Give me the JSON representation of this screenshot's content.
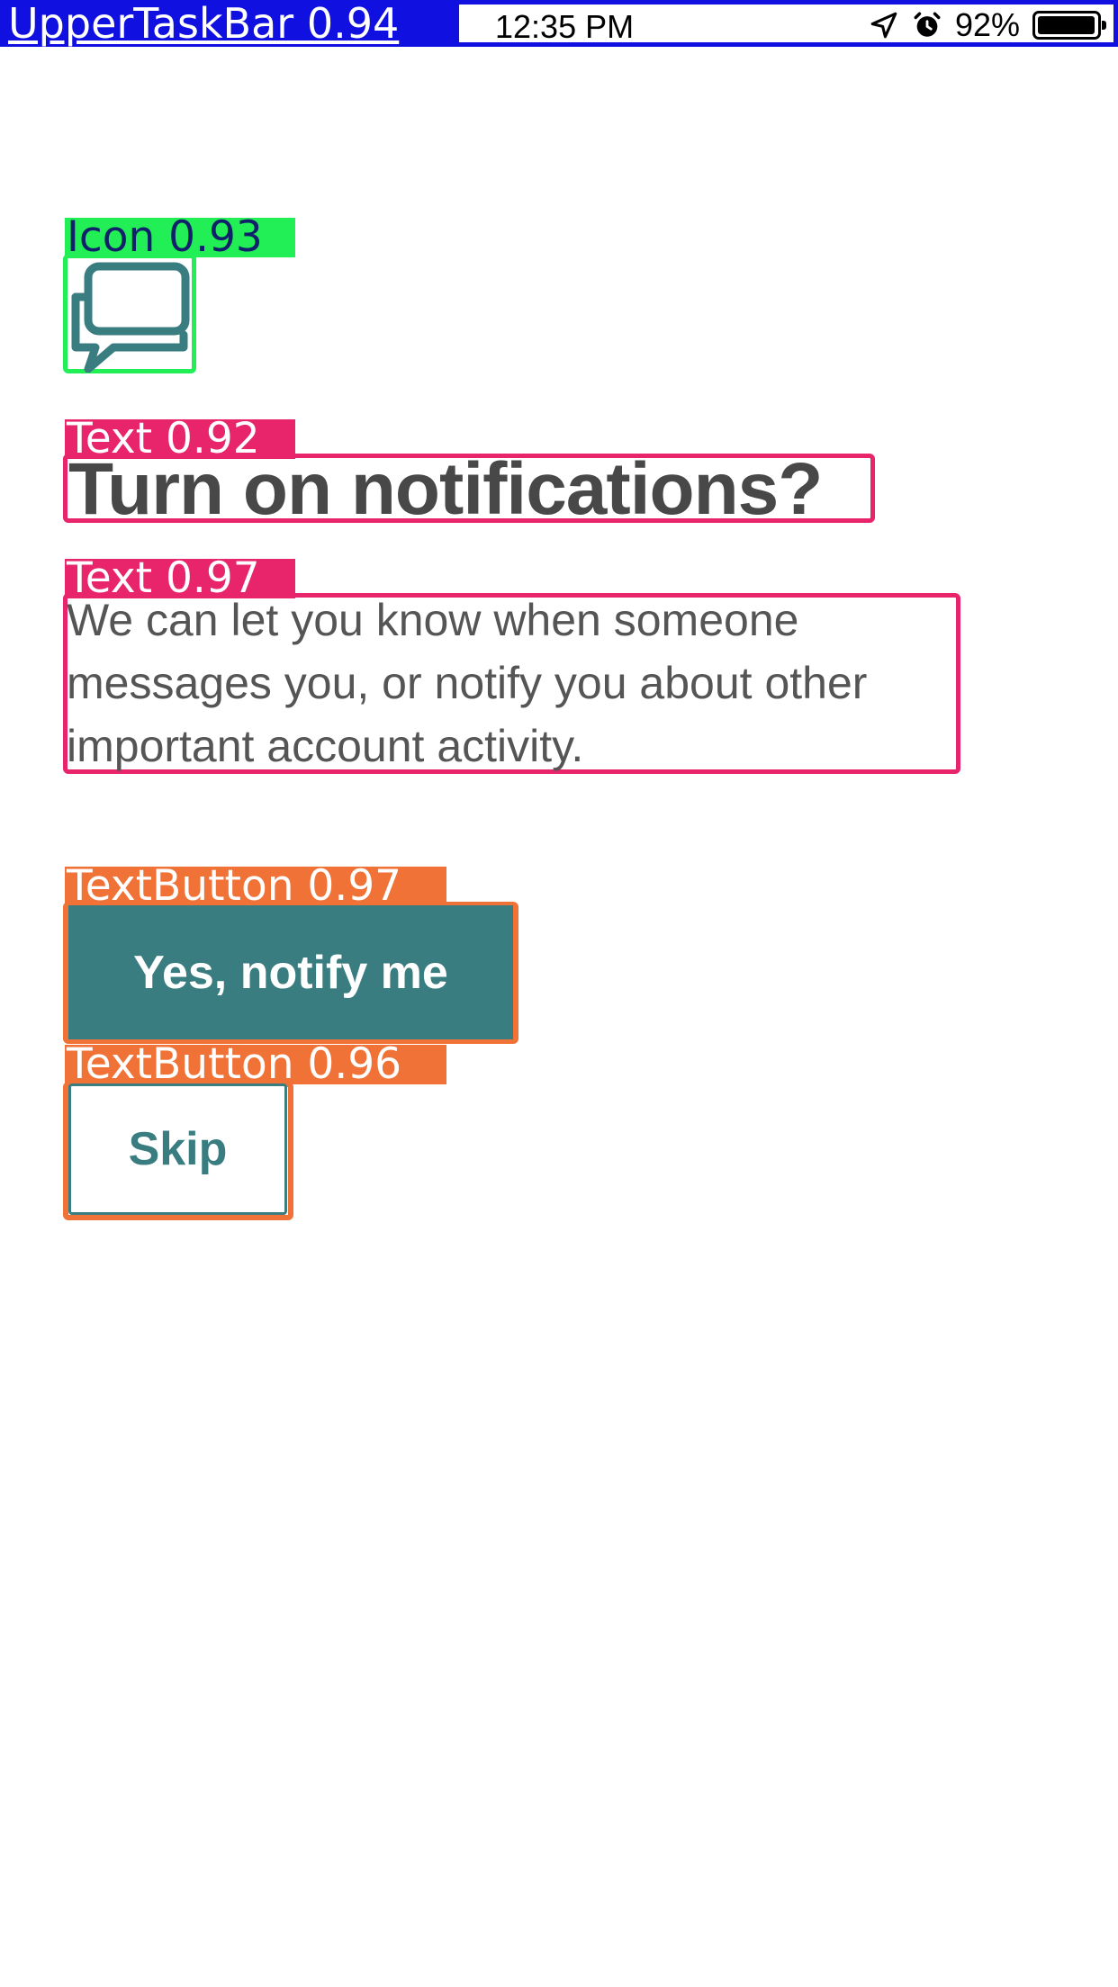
{
  "status_bar": {
    "tag_label": "UpperTaskBar  0.94",
    "time": "12:35 PM",
    "battery_percent": "92%",
    "icons": [
      "location-arrow-icon",
      "alarm-clock-icon",
      "battery-icon"
    ],
    "battery_level": 0.92
  },
  "content": {
    "icon_name": "chat-bubble-icon",
    "title": "Turn on notifications?",
    "description": "We can let you know when someone messages you, or notify you about other important account activity.",
    "primary_button": "Yes, notify me",
    "secondary_button": "Skip"
  },
  "annotations": {
    "icon_tag": "Icon  0.93",
    "title_tag": "Text  0.92",
    "description_tag": "Text  0.97",
    "primary_button_tag": "TextButton  0.97",
    "secondary_button_tag": "TextButton  0.96"
  },
  "colors": {
    "accent": "#3a7d80",
    "text": "#484848",
    "statusbar_box": "#1010e0",
    "icon_box": "#22ee55",
    "text_box": "#e8246a",
    "button_box": "#f07236"
  }
}
